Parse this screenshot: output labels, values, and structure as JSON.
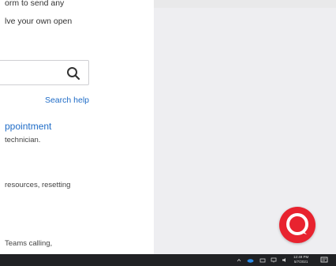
{
  "intro": {
    "line1": "orm to send any",
    "line2": "lve your own open"
  },
  "search": {
    "value": "",
    "icon": "search-icon",
    "help_link": "Search help"
  },
  "appointment": {
    "title": "ppointment",
    "description": "technician."
  },
  "resources": {
    "text": "resources, resetting"
  },
  "teams": {
    "text": "Teams calling,"
  },
  "chat_button": {
    "icon": "chat-bubble-icon",
    "color": "#e8232f"
  },
  "taskbar": {
    "time": "12:49 PM",
    "date": "5/7/2021",
    "icons": [
      "chevron-up-icon",
      "onedrive-icon",
      "network-icon",
      "display-icon",
      "volume-icon",
      "notification-icon"
    ]
  }
}
